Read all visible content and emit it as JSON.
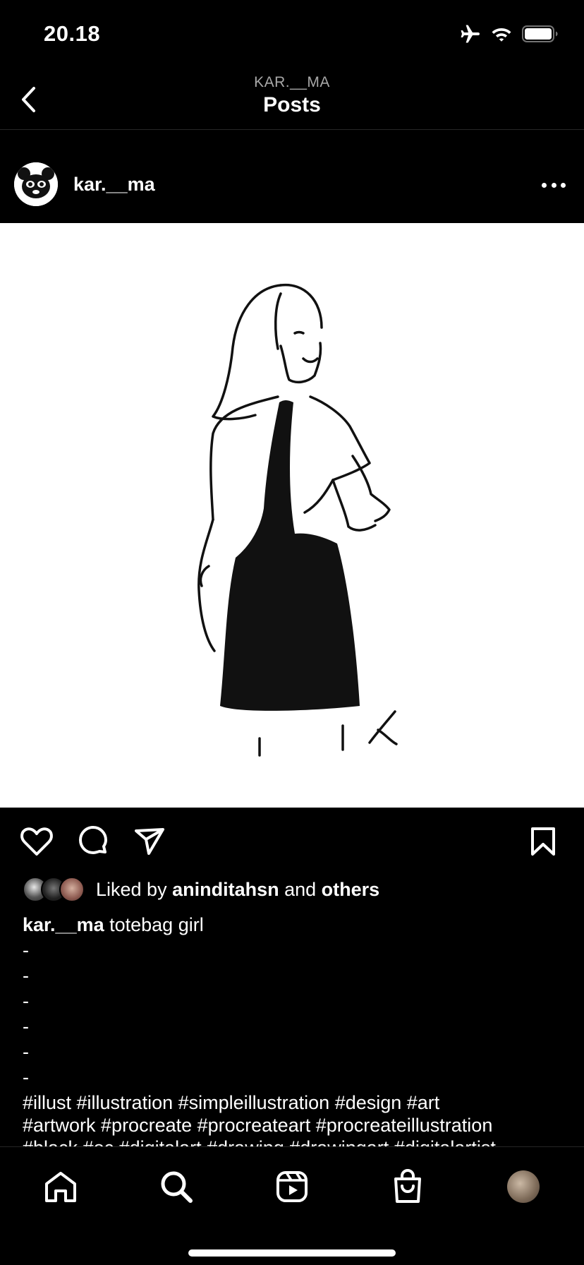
{
  "status_bar": {
    "time": "20.18",
    "icons": [
      "airplane-icon",
      "wifi-icon",
      "battery-icon"
    ]
  },
  "header": {
    "subtitle": "KAR.__MA",
    "title": "Posts"
  },
  "post": {
    "username": "kar.__ma",
    "image_description_icon": "illustration-image",
    "likes": {
      "prefix": "Liked by ",
      "user": "aninditahsn",
      "middle": " and ",
      "suffix": "others"
    },
    "caption": {
      "username": "kar.__ma",
      "text": " totebag girl",
      "dashes": [
        "-",
        "-",
        "-",
        "-",
        "-",
        "-"
      ],
      "hashtags_line1": "#illust #illustration #simpleillustration #design #art",
      "hashtags_line2": "#artwork #procreate #procreateart #procreateillustration",
      "hashtags_line3": "#black #oc #digitalart #drawing #drawingart #digitalartist"
    }
  },
  "tab_bar": {
    "items": [
      "home-icon",
      "search-icon",
      "reels-icon",
      "shop-icon",
      "profile-avatar"
    ]
  },
  "colors": {
    "background": "#000000",
    "text": "#ffffff",
    "secondary_text": "#a8a8a8",
    "divider": "#262626"
  }
}
